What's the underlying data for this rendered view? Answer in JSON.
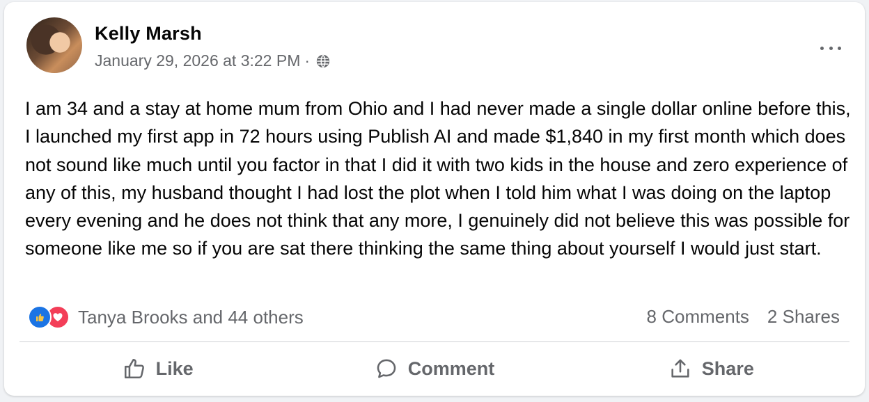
{
  "post": {
    "author": "Kelly Marsh",
    "timestamp": "January 29, 2026 at 3:22 PM",
    "separator": "·",
    "privacy_icon": "globe-icon",
    "menu_icon": "more-options-icon",
    "text": "I am 34 and a stay at home mum from Ohio and I had never made a single dollar online before this, I launched my first app in 72 hours using Publish AI and made $1,840 in my first month which does not sound like much until you factor in that I did it with two kids in the house and zero experience of any of this, my husband thought I had lost the plot when I told him what I was doing on the laptop every evening and he does not think that any more, I genuinely did not believe this was possible for someone like me so if you are sat there thinking the same thing about yourself I would just start."
  },
  "reactions": {
    "icons": [
      "like-reaction-icon",
      "love-reaction-icon"
    ],
    "summary": "Tanya Brooks and 44 others",
    "comments": "8 Comments",
    "shares": "2 Shares"
  },
  "actions": {
    "like": "Like",
    "comment": "Comment",
    "share": "Share"
  },
  "colors": {
    "like_blue": "#1b74e4",
    "love_red": "#f33e58",
    "secondary_text": "#65676b"
  }
}
